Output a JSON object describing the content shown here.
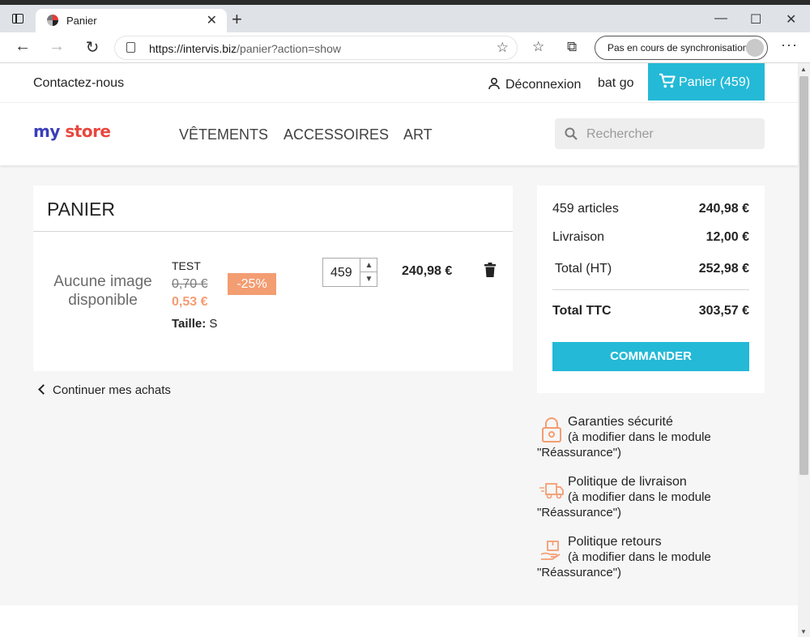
{
  "browser": {
    "tab_title": "Panier",
    "tab_close": "✕",
    "new_tab": "+",
    "url_host": "https://intervis.biz",
    "url_path": "/panier?action=show",
    "sync_label": "Pas en cours de synchronisation",
    "window_controls": {
      "minimize": "—",
      "maximize": "☐",
      "close": "✕"
    }
  },
  "header": {
    "contact": "Contactez-nous",
    "logout": "Déconnexion",
    "username": "bat go",
    "cart_label": "Panier (459)",
    "logo": {
      "my": "my",
      "store": "store"
    },
    "menu": [
      "VÊTEMENTS",
      "ACCESSOIRES",
      "ART"
    ],
    "search_placeholder": "Rechercher"
  },
  "cart": {
    "title": "PANIER",
    "item": {
      "no_image": "Aucune image disponible",
      "name": "TEST",
      "old_price": "0,70 €",
      "new_price": "0,53 €",
      "discount": "-25%",
      "size_label": "Taille:",
      "size_value": "S",
      "quantity": "459",
      "total": "240,98 €"
    },
    "continue": "Continuer mes achats"
  },
  "summary": {
    "rows": [
      {
        "label": "459 articles",
        "value": "240,98 €"
      },
      {
        "label": "Livraison",
        "value": "12,00 €"
      },
      {
        "label": "Total (HT)",
        "value": "252,98 €"
      }
    ],
    "total_label": "Total TTC",
    "total_value": "303,57 €",
    "checkout": "COMMANDER"
  },
  "reassurance": [
    {
      "icon": "lock-icon",
      "title": "Garanties sécurité",
      "line2": "(à modifier dans le module",
      "line3": "\"Réassurance\")"
    },
    {
      "icon": "truck-icon",
      "title": "Politique de livraison",
      "line2": "(à modifier dans le module",
      "line3": "\"Réassurance\")"
    },
    {
      "icon": "return-box-icon",
      "title": "Politique retours",
      "line2": "(à modifier dans le module",
      "line3": "\"Réassurance\")"
    }
  ],
  "colors": {
    "accent": "#24b9d7",
    "discount": "#f39d72",
    "reassurance_icon": "#f39d72"
  }
}
